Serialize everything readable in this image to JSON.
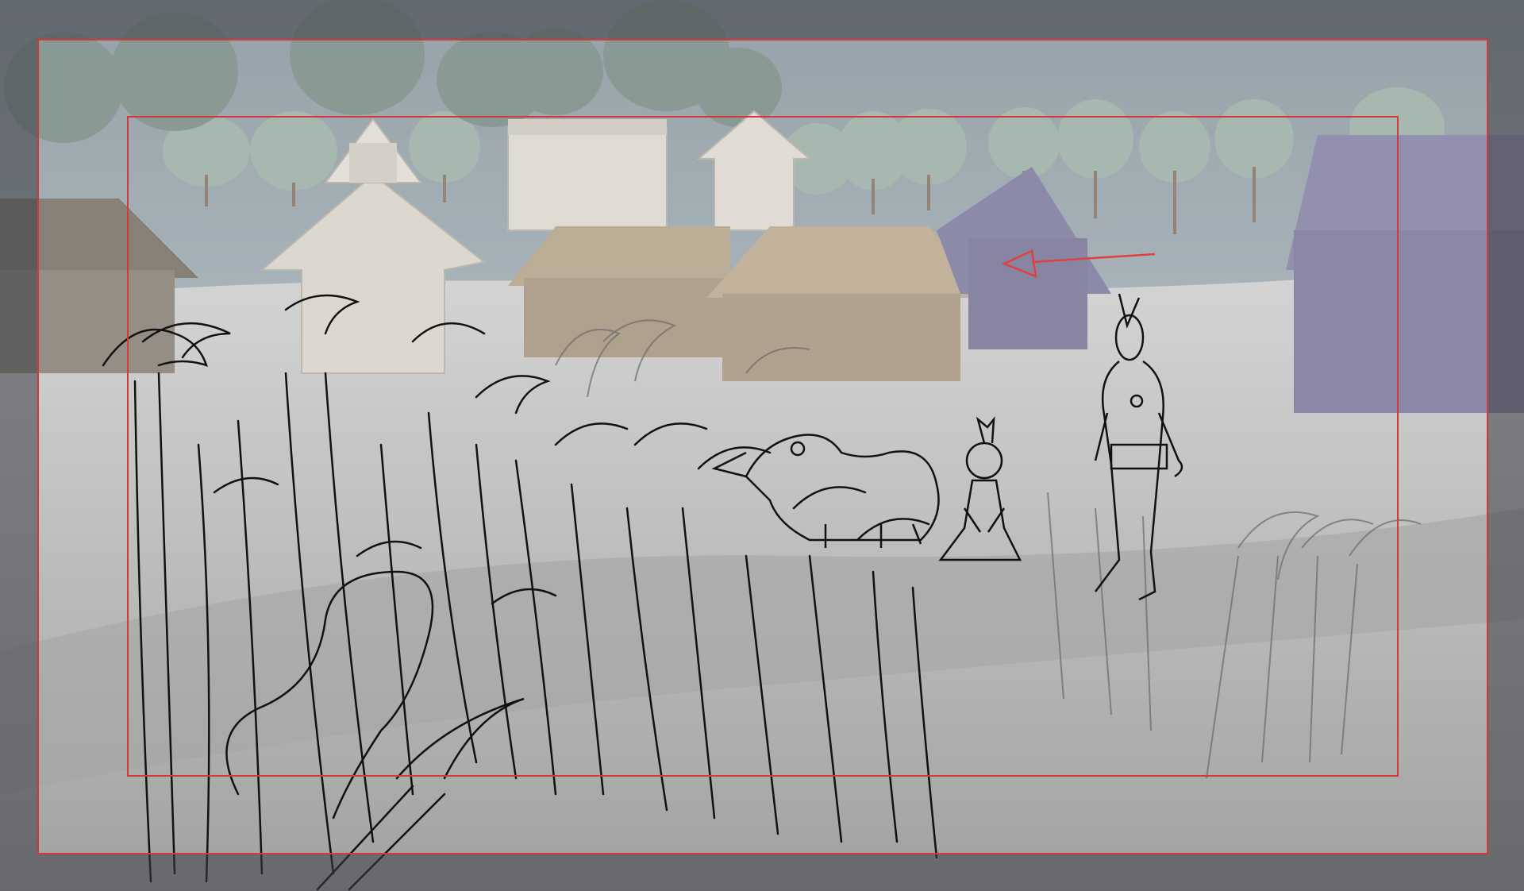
{
  "scene": {
    "kind": "storyboard-overlay",
    "colors": {
      "sky": "#b9c7cf",
      "sky_top": "#7f8b93",
      "ground": "#c9c9c9",
      "ground_dark": "#8f8f8f",
      "tree": "#8fa39c",
      "tree_dark": "#62736d",
      "house_tan": "#a99a85",
      "house_tan_dark": "#8c7e6c",
      "house_purple": "#7f7d9c",
      "house_purple_dark": "#6b6a87",
      "shrine": "#d8d4cc",
      "sketch_line": "#111111",
      "sketch_faint": "#5e5e5e",
      "safe_frame": "#d23a3a",
      "arrow": "#e04040",
      "outer_dim": "#555a60"
    },
    "icons": {
      "annotation_arrow": "arrow-icon"
    }
  }
}
